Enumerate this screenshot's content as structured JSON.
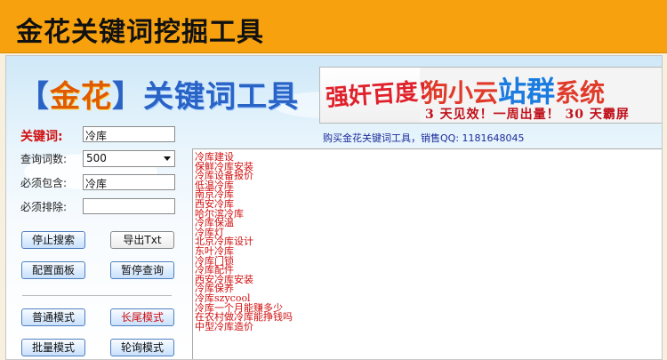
{
  "app": {
    "title": "金花关键词挖掘工具"
  },
  "logo": {
    "bracket_left": "【",
    "brand": "金花",
    "bracket_right": "】",
    "rest": "关键词工具"
  },
  "banner": {
    "left_text": "强奸百度!",
    "right_prefix": "狗小云",
    "right_big": "站群",
    "right_suffix": "系统",
    "bottom_text": "3 天见效！一周出量！ 30 天霸屏"
  },
  "sales_line": "购买金花关键词工具，销售QQ: 1181648045",
  "form": {
    "keyword_label": "关键词:",
    "keyword_value": "冷库",
    "count_label": "查询词数:",
    "count_value": "500",
    "include_label": "必须包含:",
    "include_value": "冷库",
    "exclude_label": "必须排除:",
    "exclude_value": ""
  },
  "buttons": {
    "stop_search": "停止搜索",
    "export_txt": "导出Txt",
    "config_panel": "配置面板",
    "pause_query": "暂停查询",
    "normal_mode": "普通模式",
    "long_tail_mode": "长尾模式",
    "batch_mode": "批量模式",
    "poll_mode": "轮询模式"
  },
  "results": [
    "冷库建设",
    "保鲜冷库安装",
    "冷库设备报价",
    "低温冷库",
    "南京冷库",
    "西安冷库",
    "哈尔滨冷库",
    "冷库保温",
    "冷库灯",
    "北京冷库设计",
    "东叶冷库",
    "冷库门锁",
    "冷库配件",
    "西安冷库安装",
    "冷库保养",
    "冷库szycool",
    "冷库一个月能赚多少",
    "在农村做冷库能挣钱吗",
    "中型冷库造价"
  ],
  "colors": {
    "header": "#f7a10f",
    "accent_red": "#d01010",
    "link_blue": "#1a2a9a"
  }
}
